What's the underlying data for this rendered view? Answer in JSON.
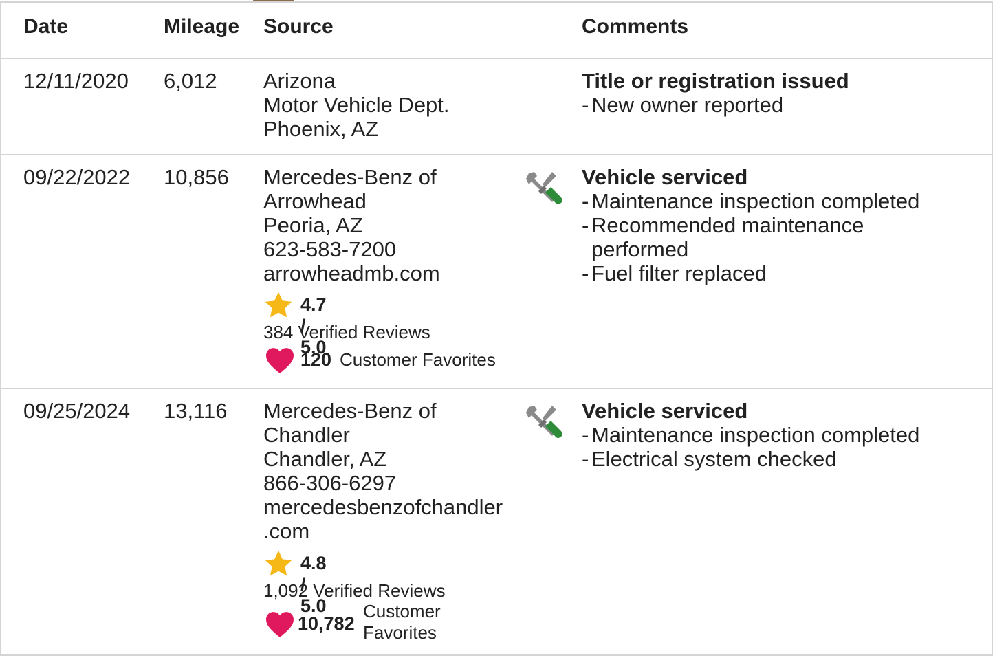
{
  "table": {
    "headers": {
      "date": "Date",
      "mileage": "Mileage",
      "source": "Source",
      "comments": "Comments"
    },
    "rows": [
      {
        "date": "12/11/2020",
        "mileage": "6,012",
        "source_lines": [
          "Arizona",
          "Motor Vehicle Dept.",
          "Phoenix, AZ"
        ],
        "comment_title": "Title or registration issued",
        "comment_items": [
          "New owner reported"
        ]
      },
      {
        "date": "09/22/2022",
        "mileage": "10,856",
        "source_lines": [
          "Mercedes-Benz of",
          "Arrowhead",
          "Peoria, AZ",
          "623-583-7200",
          "arrowheadmb.com"
        ],
        "rating": "4.7 / 5.0",
        "reviews": "384 Verified Reviews",
        "favorites_count": "120",
        "favorites_label": "Customer Favorites",
        "icon": "service-wrench-screwdriver-icon",
        "comment_title": "Vehicle serviced",
        "comment_items": [
          "Maintenance inspection completed",
          "Recommended maintenance performed",
          "Fuel filter replaced"
        ]
      },
      {
        "date": "09/25/2024",
        "mileage": "13,116",
        "source_lines": [
          "Mercedes-Benz of",
          "Chandler",
          "Chandler, AZ",
          "866-306-6297",
          "mercedesbenzofchandler",
          ".com"
        ],
        "rating": "4.8 / 5.0",
        "reviews": "1,092 Verified Reviews",
        "favorites_count": "10,782",
        "favorites_label_lines": [
          "Customer",
          "Favorites"
        ],
        "icon": "service-wrench-screwdriver-icon",
        "comment_title": "Vehicle serviced",
        "comment_items": [
          "Maintenance inspection completed",
          "Electrical system checked"
        ]
      }
    ]
  },
  "colors": {
    "star": "#f6b817",
    "heart": "#e0195f",
    "screwdriver": "#2e8b3a",
    "wrench": "#8a8a8a",
    "border": "#d4d4d4"
  }
}
